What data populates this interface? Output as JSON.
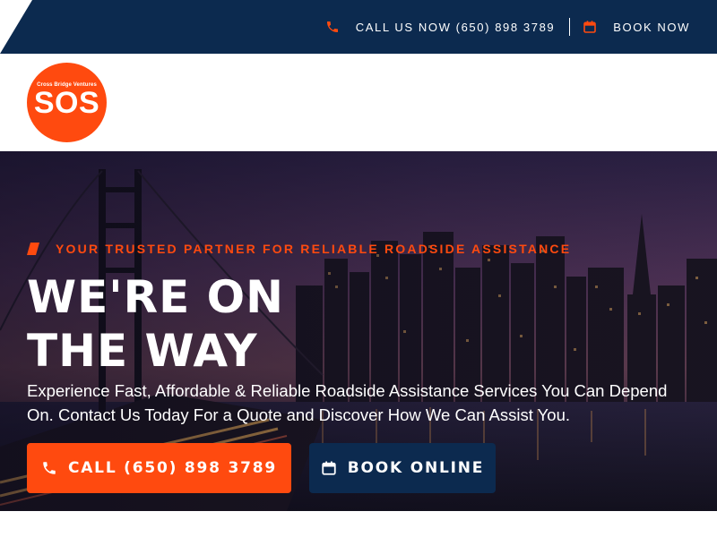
{
  "topbar": {
    "call_label": "CALL US NOW (650) 898 3789",
    "book_label": "BOOK NOW",
    "call_icon": "phone-icon",
    "book_icon": "calendar-icon"
  },
  "logo": {
    "small_text": "Cross Bridge Ventures",
    "big_text": "SOS"
  },
  "hero": {
    "eyebrow": "YOUR TRUSTED PARTNER FOR RELIABLE ROADSIDE ASSISTANCE",
    "title_line1": "WE'RE ON",
    "title_line2": "THE WAY",
    "description": "Experience Fast, Affordable & Reliable Roadside Assistance Services You Can Depend On. Contact Us Today For a Quote and Discover How We Can Assist You.",
    "call_button": "CALL (650) 898 3789",
    "book_button": "BOOK ONLINE"
  },
  "colors": {
    "brand_orange": "#ff4a0f",
    "brand_navy": "#0c2a4f",
    "white": "#ffffff"
  }
}
